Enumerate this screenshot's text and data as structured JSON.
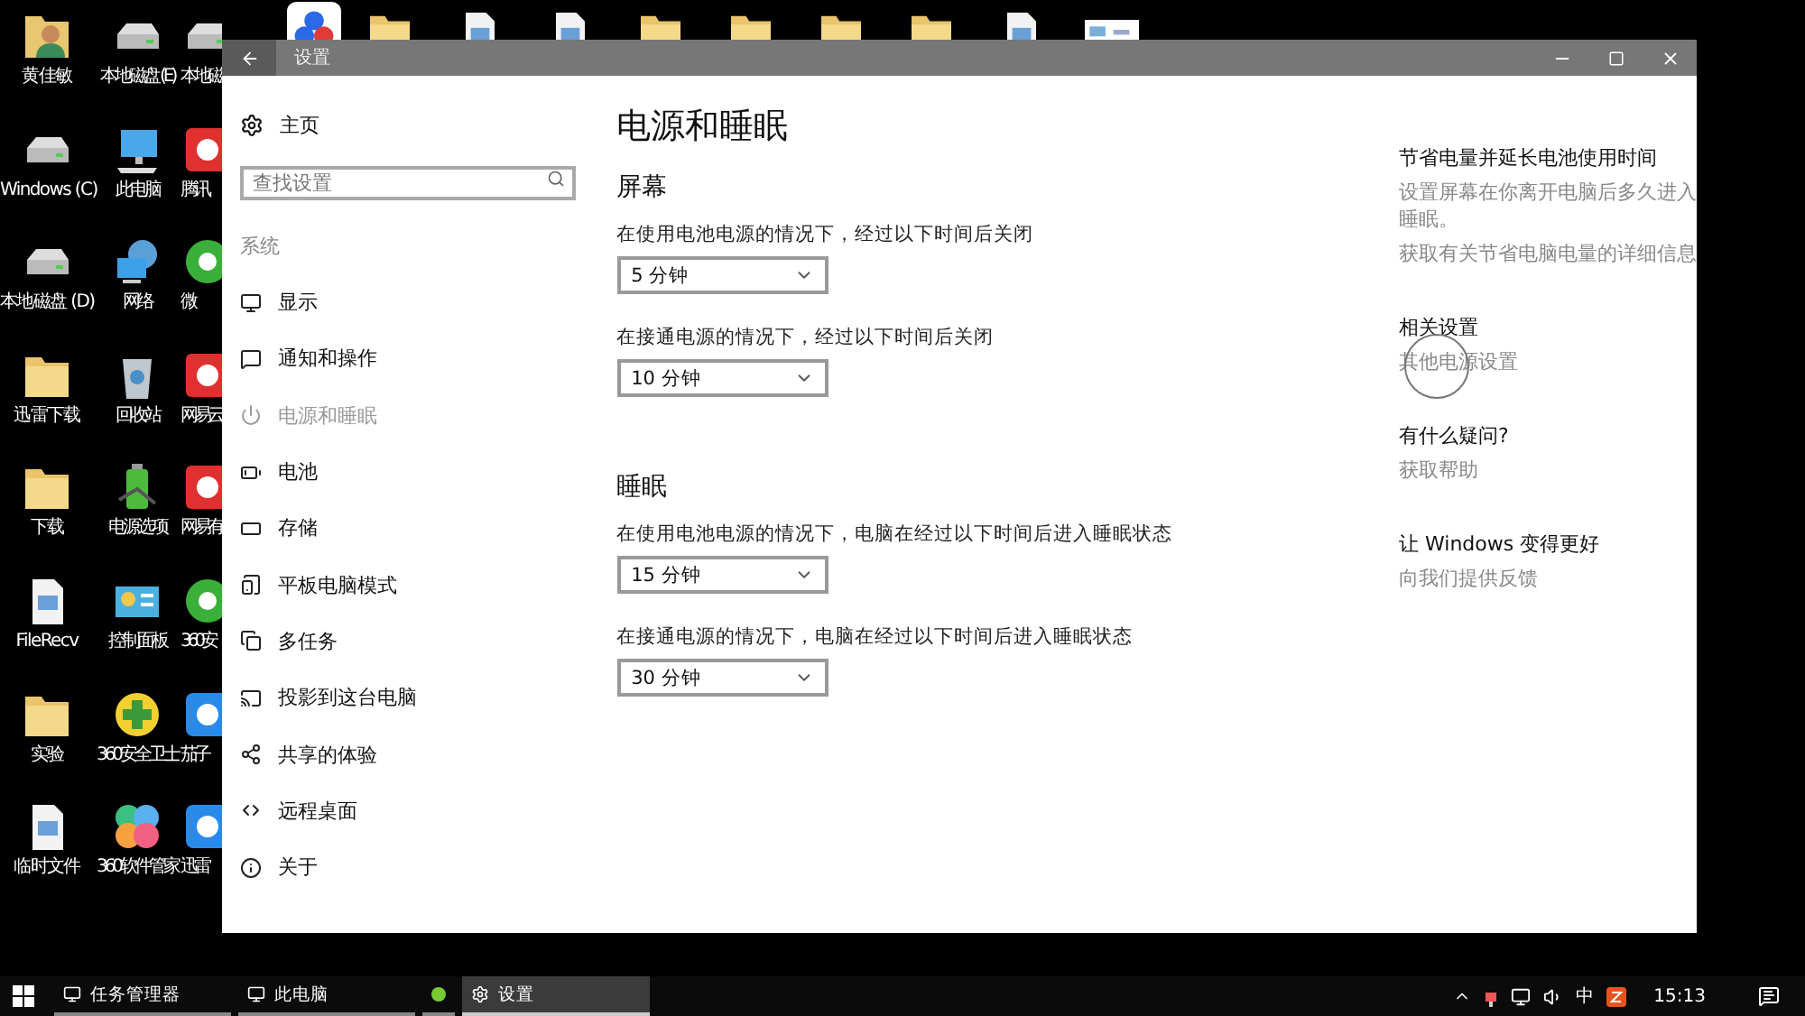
{
  "desktop": {
    "columns": [
      [
        {
          "label": "黄佳敏",
          "kind": "user"
        },
        {
          "label": "Windows (C)",
          "kind": "drive"
        },
        {
          "label": "本地磁盘 (D)",
          "kind": "drive"
        },
        {
          "label": "迅雷下载",
          "kind": "folder"
        },
        {
          "label": "下载",
          "kind": "folder"
        },
        {
          "label": "FileRecv",
          "kind": "doc"
        },
        {
          "label": "实验",
          "kind": "folder"
        },
        {
          "label": "临时文件",
          "kind": "doc"
        }
      ],
      [
        {
          "label": "本地磁盘 (E)",
          "kind": "drive"
        },
        {
          "label": "此电脑",
          "kind": "computer"
        },
        {
          "label": "网络",
          "kind": "network"
        },
        {
          "label": "回收站",
          "kind": "recycle"
        },
        {
          "label": "电源选项",
          "kind": "battery"
        },
        {
          "label": "控制面板",
          "kind": "panel"
        },
        {
          "label": "360安全卫士",
          "kind": "guard"
        },
        {
          "label": "360软件管家",
          "kind": "flower"
        }
      ],
      [
        {
          "label": "本地磁",
          "kind": "drive"
        },
        {
          "label": "腾讯",
          "kind": "red"
        },
        {
          "label": "微",
          "kind": "green"
        },
        {
          "label": "网易云",
          "kind": "red"
        },
        {
          "label": "网易有",
          "kind": "red"
        },
        {
          "label": "360安",
          "kind": "green"
        },
        {
          "label": "茄子",
          "kind": "blue"
        },
        {
          "label": "迅雷",
          "kind": "blue"
        }
      ]
    ],
    "top_icons": [
      {
        "kind": "app"
      },
      {
        "kind": "folder"
      },
      {
        "kind": "doc"
      },
      {
        "kind": "doc"
      },
      {
        "kind": "folder"
      },
      {
        "kind": "folder"
      },
      {
        "kind": "folder"
      },
      {
        "kind": "folder"
      },
      {
        "kind": "doc"
      },
      {
        "kind": "shot"
      }
    ]
  },
  "window": {
    "title": "设置"
  },
  "nav": {
    "home": "主页",
    "search": {
      "placeholder": "查找设置"
    },
    "section": "系统",
    "items": [
      {
        "label": "显示",
        "selected": false
      },
      {
        "label": "通知和操作",
        "selected": false
      },
      {
        "label": "电源和睡眠",
        "selected": true
      },
      {
        "label": "电池",
        "selected": false
      },
      {
        "label": "存储",
        "selected": false
      },
      {
        "label": "平板电脑模式",
        "selected": false
      },
      {
        "label": "多任务",
        "selected": false
      },
      {
        "label": "投影到这台电脑",
        "selected": false
      },
      {
        "label": "共享的体验",
        "selected": false
      },
      {
        "label": "远程桌面",
        "selected": false
      },
      {
        "label": "关于",
        "selected": false
      }
    ]
  },
  "content": {
    "title": "电源和睡眠",
    "sections": [
      {
        "heading": "屏幕",
        "settings": [
          {
            "label": "在使用电池电源的情况下，经过以下时间后关闭",
            "value": "5 分钟"
          },
          {
            "label": "在接通电源的情况下，经过以下时间后关闭",
            "value": "10 分钟"
          }
        ]
      },
      {
        "heading": "睡眠",
        "settings": [
          {
            "label": "在使用电池电源的情况下，电脑在经过以下时间后进入睡眠状态",
            "value": "15 分钟"
          },
          {
            "label": "在接通电源的情况下，电脑在经过以下时间后进入睡眠状态",
            "value": "30 分钟"
          }
        ]
      }
    ]
  },
  "aside": {
    "groups": [
      {
        "heading": "节省电量并延长电池使用时间",
        "lines": [
          {
            "kind": "desc",
            "text": "设置屏幕在你离开电脑后多久进入睡眠。"
          },
          {
            "kind": "link",
            "text": "获取有关节省电脑电量的详细信息"
          }
        ]
      },
      {
        "heading": "相关设置",
        "lines": [
          {
            "kind": "link",
            "text": "其他电源设置",
            "touched": true
          }
        ]
      },
      {
        "heading": "有什么疑问?",
        "lines": [
          {
            "kind": "link",
            "text": "获取帮助"
          }
        ]
      },
      {
        "heading": "让 Windows 变得更好",
        "lines": [
          {
            "kind": "link",
            "text": "向我们提供反馈"
          }
        ]
      }
    ]
  },
  "taskbar": {
    "apps": [
      {
        "label": "任务管理器",
        "selected": false
      },
      {
        "label": "此电脑",
        "selected": false
      },
      {
        "selected": false
      },
      {
        "label": "设置",
        "selected": true
      }
    ],
    "ime": "中",
    "time": "15:13"
  }
}
